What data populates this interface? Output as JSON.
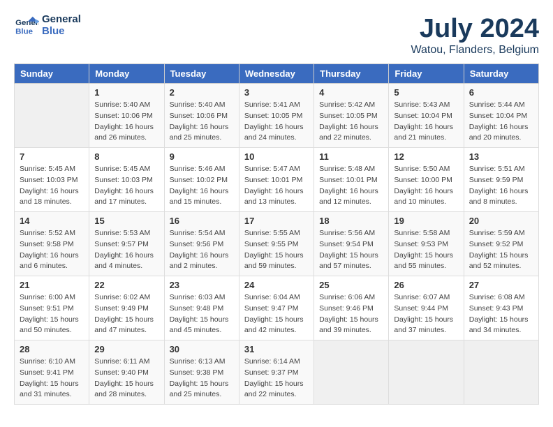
{
  "header": {
    "logo_line1": "General",
    "logo_line2": "Blue",
    "month_year": "July 2024",
    "location": "Watou, Flanders, Belgium"
  },
  "weekdays": [
    "Sunday",
    "Monday",
    "Tuesday",
    "Wednesday",
    "Thursday",
    "Friday",
    "Saturday"
  ],
  "weeks": [
    [
      {
        "day": "",
        "info": ""
      },
      {
        "day": "1",
        "info": "Sunrise: 5:40 AM\nSunset: 10:06 PM\nDaylight: 16 hours\nand 26 minutes."
      },
      {
        "day": "2",
        "info": "Sunrise: 5:40 AM\nSunset: 10:06 PM\nDaylight: 16 hours\nand 25 minutes."
      },
      {
        "day": "3",
        "info": "Sunrise: 5:41 AM\nSunset: 10:05 PM\nDaylight: 16 hours\nand 24 minutes."
      },
      {
        "day": "4",
        "info": "Sunrise: 5:42 AM\nSunset: 10:05 PM\nDaylight: 16 hours\nand 22 minutes."
      },
      {
        "day": "5",
        "info": "Sunrise: 5:43 AM\nSunset: 10:04 PM\nDaylight: 16 hours\nand 21 minutes."
      },
      {
        "day": "6",
        "info": "Sunrise: 5:44 AM\nSunset: 10:04 PM\nDaylight: 16 hours\nand 20 minutes."
      }
    ],
    [
      {
        "day": "7",
        "info": "Sunrise: 5:45 AM\nSunset: 10:03 PM\nDaylight: 16 hours\nand 18 minutes."
      },
      {
        "day": "8",
        "info": "Sunrise: 5:45 AM\nSunset: 10:03 PM\nDaylight: 16 hours\nand 17 minutes."
      },
      {
        "day": "9",
        "info": "Sunrise: 5:46 AM\nSunset: 10:02 PM\nDaylight: 16 hours\nand 15 minutes."
      },
      {
        "day": "10",
        "info": "Sunrise: 5:47 AM\nSunset: 10:01 PM\nDaylight: 16 hours\nand 13 minutes."
      },
      {
        "day": "11",
        "info": "Sunrise: 5:48 AM\nSunset: 10:01 PM\nDaylight: 16 hours\nand 12 minutes."
      },
      {
        "day": "12",
        "info": "Sunrise: 5:50 AM\nSunset: 10:00 PM\nDaylight: 16 hours\nand 10 minutes."
      },
      {
        "day": "13",
        "info": "Sunrise: 5:51 AM\nSunset: 9:59 PM\nDaylight: 16 hours\nand 8 minutes."
      }
    ],
    [
      {
        "day": "14",
        "info": "Sunrise: 5:52 AM\nSunset: 9:58 PM\nDaylight: 16 hours\nand 6 minutes."
      },
      {
        "day": "15",
        "info": "Sunrise: 5:53 AM\nSunset: 9:57 PM\nDaylight: 16 hours\nand 4 minutes."
      },
      {
        "day": "16",
        "info": "Sunrise: 5:54 AM\nSunset: 9:56 PM\nDaylight: 16 hours\nand 2 minutes."
      },
      {
        "day": "17",
        "info": "Sunrise: 5:55 AM\nSunset: 9:55 PM\nDaylight: 15 hours\nand 59 minutes."
      },
      {
        "day": "18",
        "info": "Sunrise: 5:56 AM\nSunset: 9:54 PM\nDaylight: 15 hours\nand 57 minutes."
      },
      {
        "day": "19",
        "info": "Sunrise: 5:58 AM\nSunset: 9:53 PM\nDaylight: 15 hours\nand 55 minutes."
      },
      {
        "day": "20",
        "info": "Sunrise: 5:59 AM\nSunset: 9:52 PM\nDaylight: 15 hours\nand 52 minutes."
      }
    ],
    [
      {
        "day": "21",
        "info": "Sunrise: 6:00 AM\nSunset: 9:51 PM\nDaylight: 15 hours\nand 50 minutes."
      },
      {
        "day": "22",
        "info": "Sunrise: 6:02 AM\nSunset: 9:49 PM\nDaylight: 15 hours\nand 47 minutes."
      },
      {
        "day": "23",
        "info": "Sunrise: 6:03 AM\nSunset: 9:48 PM\nDaylight: 15 hours\nand 45 minutes."
      },
      {
        "day": "24",
        "info": "Sunrise: 6:04 AM\nSunset: 9:47 PM\nDaylight: 15 hours\nand 42 minutes."
      },
      {
        "day": "25",
        "info": "Sunrise: 6:06 AM\nSunset: 9:46 PM\nDaylight: 15 hours\nand 39 minutes."
      },
      {
        "day": "26",
        "info": "Sunrise: 6:07 AM\nSunset: 9:44 PM\nDaylight: 15 hours\nand 37 minutes."
      },
      {
        "day": "27",
        "info": "Sunrise: 6:08 AM\nSunset: 9:43 PM\nDaylight: 15 hours\nand 34 minutes."
      }
    ],
    [
      {
        "day": "28",
        "info": "Sunrise: 6:10 AM\nSunset: 9:41 PM\nDaylight: 15 hours\nand 31 minutes."
      },
      {
        "day": "29",
        "info": "Sunrise: 6:11 AM\nSunset: 9:40 PM\nDaylight: 15 hours\nand 28 minutes."
      },
      {
        "day": "30",
        "info": "Sunrise: 6:13 AM\nSunset: 9:38 PM\nDaylight: 15 hours\nand 25 minutes."
      },
      {
        "day": "31",
        "info": "Sunrise: 6:14 AM\nSunset: 9:37 PM\nDaylight: 15 hours\nand 22 minutes."
      },
      {
        "day": "",
        "info": ""
      },
      {
        "day": "",
        "info": ""
      },
      {
        "day": "",
        "info": ""
      }
    ]
  ]
}
